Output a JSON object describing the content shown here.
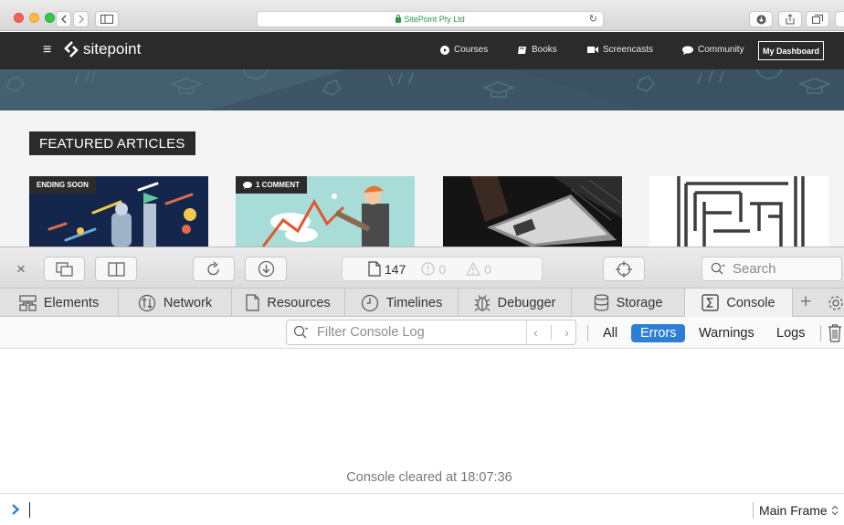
{
  "browser": {
    "url": "SitePoint Pty Ltd"
  },
  "site": {
    "logo": "sitepoint",
    "nav": [
      {
        "label": "Courses",
        "icon": "play-circle-icon"
      },
      {
        "label": "Books",
        "icon": "book-icon"
      },
      {
        "label": "Screencasts",
        "icon": "video-camera-icon"
      },
      {
        "label": "Community",
        "icon": "chat-bubble-icon"
      }
    ],
    "dashboard_button": "My Dashboard",
    "featured_heading": "FEATURED ARTICLES",
    "cards": [
      {
        "badge": "ENDING SOON"
      },
      {
        "badge": "1 COMMENT"
      },
      {
        "badge": ""
      },
      {
        "badge": ""
      }
    ]
  },
  "inspector": {
    "resource_count": "147",
    "error_count": "0",
    "warning_count": "0",
    "search_placeholder": "Search",
    "tabs": [
      {
        "label": "Elements",
        "icon": "elements-icon"
      },
      {
        "label": "Network",
        "icon": "network-icon"
      },
      {
        "label": "Resources",
        "icon": "document-icon"
      },
      {
        "label": "Timelines",
        "icon": "clock-icon"
      },
      {
        "label": "Debugger",
        "icon": "bug-icon"
      },
      {
        "label": "Storage",
        "icon": "database-icon"
      },
      {
        "label": "Console",
        "icon": "console-icon",
        "active": true
      }
    ],
    "filter_placeholder": "Filter Console Log",
    "scopes": [
      "All",
      "Errors",
      "Warnings",
      "Logs"
    ],
    "active_scope": "Errors",
    "cleared_message": "Console cleared at 18:07:36",
    "frame_selector": "Main Frame",
    "accent_color": "#2d7fd3"
  }
}
